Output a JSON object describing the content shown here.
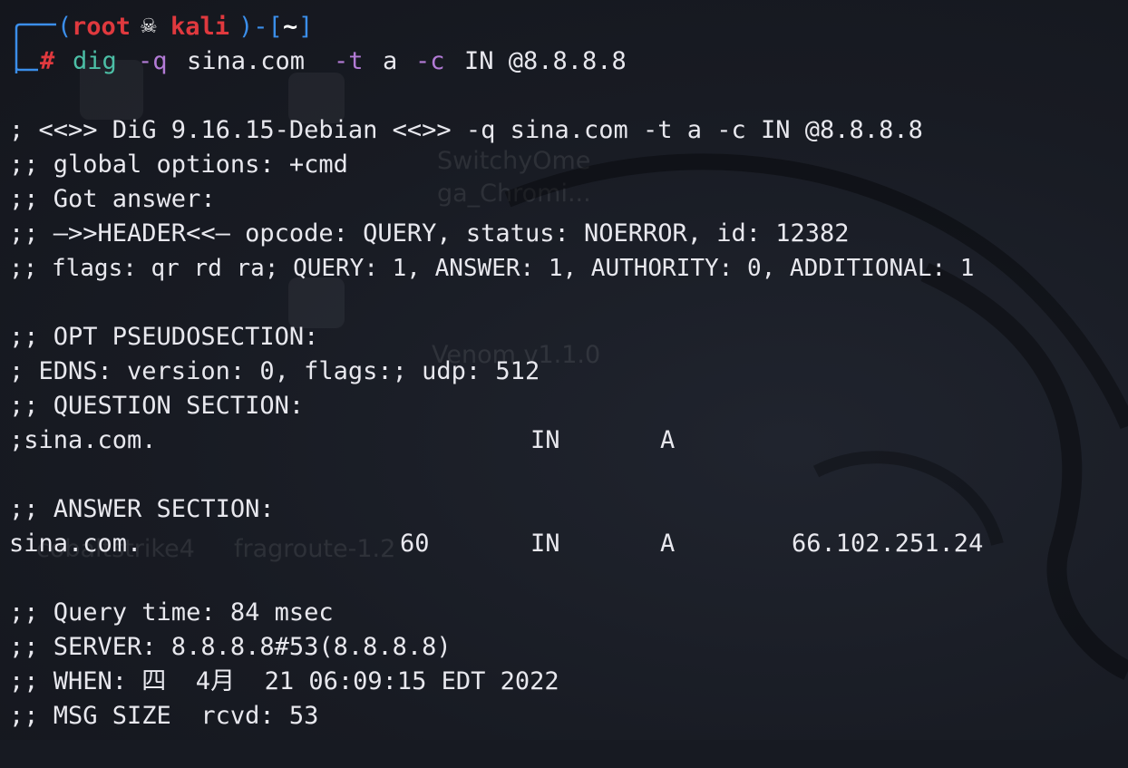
{
  "prompt": {
    "open": "(",
    "user": "root",
    "skull": "💀",
    "host": "kali",
    "close_dash": ")-[",
    "cwd": "~",
    "close_bracket": "]",
    "symbol": "#"
  },
  "command": {
    "program": "dig",
    "flag_q": "-q",
    "domain": "sina.com",
    "flag_t": "-t",
    "type": "a",
    "flag_c": "-c",
    "class_server": "IN @8.8.8.8"
  },
  "output": {
    "banner": "; <<>> DiG 9.16.15-Debian <<>> -q sina.com -t a -c IN @8.8.8.8",
    "global_options": ";; global options: +cmd",
    "got_answer": ";; Got answer:",
    "header": ";; —>>HEADER<<— opcode: QUERY, status: NOERROR, id: 12382",
    "flags": ";; flags: qr rd ra; QUERY: 1, ANSWER: 1, AUTHORITY: 0, ADDITIONAL: 1",
    "opt_section": ";; OPT PSEUDOSECTION:",
    "edns": "; EDNS: version: 0, flags:; udp: 512",
    "question_section": ";; QUESTION SECTION:",
    "question": {
      "name": ";sina.com.",
      "class": "IN",
      "type": "A"
    },
    "answer_section": ";; ANSWER SECTION:",
    "answer": {
      "name": "sina.com.",
      "ttl": "60",
      "class": "IN",
      "type": "A",
      "address": "66.102.251.24"
    },
    "query_time": ";; Query time: 84 msec",
    "server": ";; SERVER: 8.8.8.8#53(8.8.8.8)",
    "when": ";; WHEN: 四  4月  21 06:09:15 EDT 2022",
    "msg_size": ";; MSG SIZE  rcvd: 53"
  },
  "desktop_ghosts": {
    "label_1": "SwitchyOme",
    "label_2": "ga_Chromi...",
    "label_3": "Venom v1.1.0",
    "label_4": "fragroute-1.2",
    "label_5": "cobaltstrike4"
  },
  "colors": {
    "background": "#171a22",
    "prompt_frame": "#3b8eea",
    "prompt_user": "#e0393e",
    "command": "#4cbfa6",
    "option": "#b37bd6",
    "text": "#e8e8ee"
  }
}
